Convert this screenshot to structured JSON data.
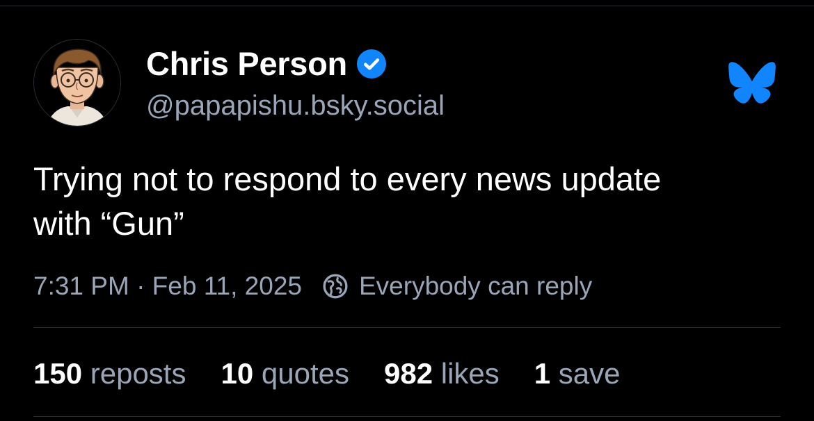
{
  "post": {
    "author": {
      "display_name": "Chris Person",
      "handle": "@papapishu.bsky.social",
      "verified": true,
      "avatar_icon": "cartoon-portrait-avatar"
    },
    "logo_icon": "bluesky-butterfly-icon",
    "text_line1": "Trying not to respond to every news update",
    "text_line2": "with “Gun”",
    "timestamp": "7:31 PM · Feb 11, 2025",
    "reply_setting": "Everybody can reply",
    "stats": [
      {
        "count": "150",
        "label": "reposts"
      },
      {
        "count": "10",
        "label": "quotes"
      },
      {
        "count": "982",
        "label": "likes"
      },
      {
        "count": "1",
        "label": "save"
      }
    ]
  },
  "colors": {
    "background": "#000000",
    "text": "#ffffff",
    "muted": "#9aa6b8",
    "brand": "#1185fe",
    "divider": "#2a2d33"
  }
}
